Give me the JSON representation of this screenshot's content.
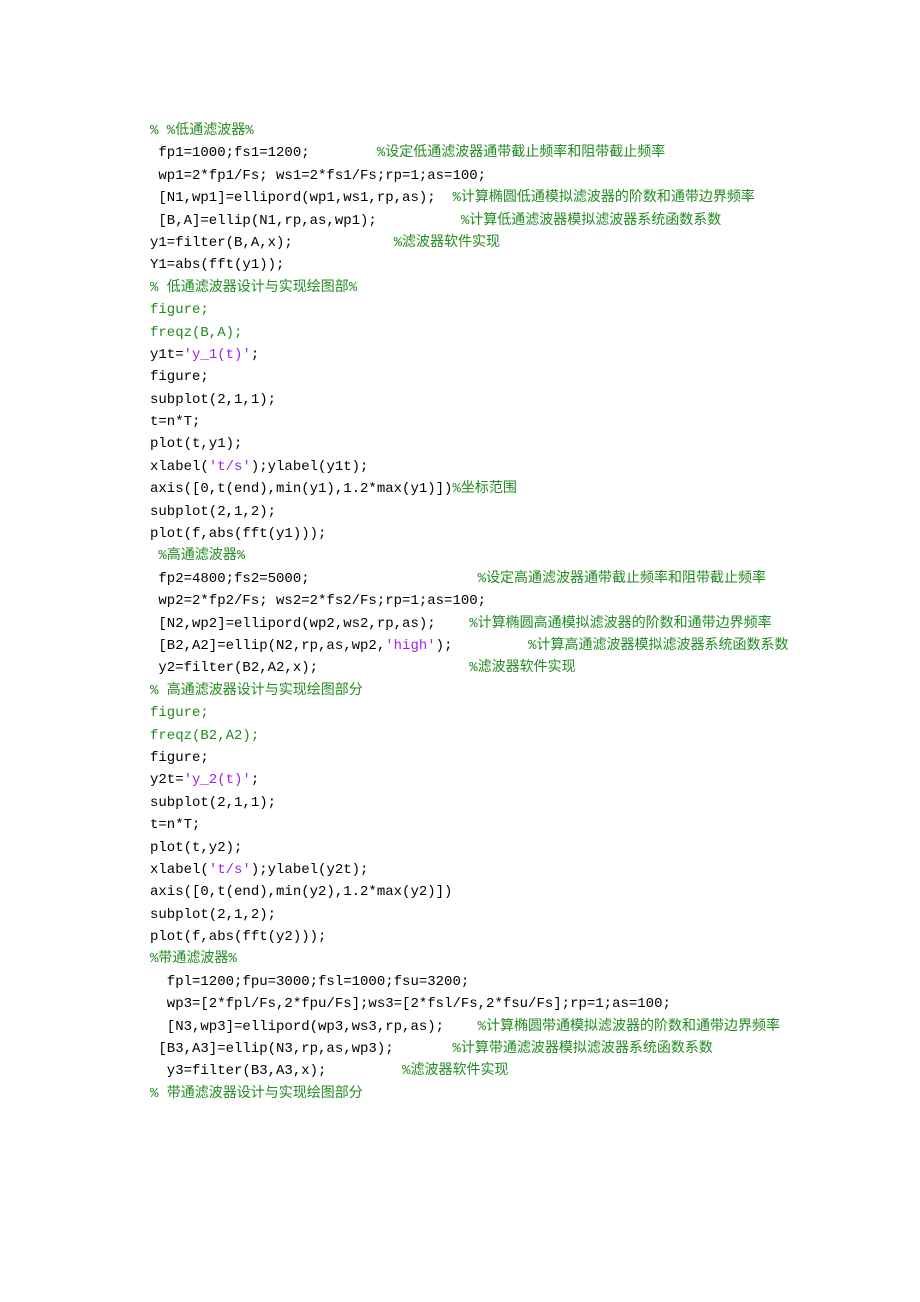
{
  "lines": [
    [
      {
        "t": "% %低通滤波器%",
        "cls": "comment"
      }
    ],
    [
      {
        "t": " fp1=1000;fs1=1200;        ",
        "cls": ""
      },
      {
        "t": "%设定低通滤波器通带截止频率和阻带截止频率",
        "cls": "comment"
      }
    ],
    [
      {
        "t": " wp1=2*fp1/Fs; ws1=2*fs1/Fs;rp=1;as=100;",
        "cls": ""
      }
    ],
    [
      {
        "t": " [N1,wp1]=ellipord(wp1,ws1,rp,as);  ",
        "cls": ""
      },
      {
        "t": "%计算椭圆低通模拟滤波器的阶数和通带边界频率",
        "cls": "comment"
      }
    ],
    [
      {
        "t": " [B,A]=ellip(N1,rp,as,wp1);          ",
        "cls": ""
      },
      {
        "t": "%计算低通滤波器模拟滤波器系统函数系数",
        "cls": "comment"
      }
    ],
    [
      {
        "t": "y1=filter(B,A,x);            ",
        "cls": ""
      },
      {
        "t": "%滤波器软件实现",
        "cls": "comment"
      }
    ],
    [
      {
        "t": "Y1=abs(fft(y1));",
        "cls": ""
      }
    ],
    [
      {
        "t": "% 低通滤波器设计与实现绘图部%",
        "cls": "comment"
      }
    ],
    [
      {
        "t": "figure;",
        "cls": "comment"
      }
    ],
    [
      {
        "t": "freqz(B,A);",
        "cls": "comment"
      }
    ],
    [
      {
        "t": "y1t=",
        "cls": ""
      },
      {
        "t": "'y_1(t)'",
        "cls": "string"
      },
      {
        "t": ";",
        "cls": ""
      }
    ],
    [
      {
        "t": "figure;",
        "cls": ""
      }
    ],
    [
      {
        "t": "subplot(2,1,1);",
        "cls": ""
      }
    ],
    [
      {
        "t": "t=n*T;",
        "cls": ""
      }
    ],
    [
      {
        "t": "plot(t,y1);",
        "cls": ""
      }
    ],
    [
      {
        "t": "xlabel(",
        "cls": ""
      },
      {
        "t": "'t/s'",
        "cls": "string"
      },
      {
        "t": ");ylabel(y1t);",
        "cls": ""
      }
    ],
    [
      {
        "t": "axis([0,t(end),min(y1),1.2*max(y1)])",
        "cls": ""
      },
      {
        "t": "%坐标范围",
        "cls": "comment"
      }
    ],
    [
      {
        "t": "subplot(2,1,2);",
        "cls": ""
      }
    ],
    [
      {
        "t": "plot(f,abs(fft(y1)));",
        "cls": ""
      }
    ],
    [
      {
        "t": " %高通滤波器%",
        "cls": "comment"
      }
    ],
    [
      {
        "t": " fp2=4800;fs2=5000;                    ",
        "cls": ""
      },
      {
        "t": "%设定高通滤波器通带截止频率和阻带截止频率",
        "cls": "comment"
      }
    ],
    [
      {
        "t": " wp2=2*fp2/Fs; ws2=2*fs2/Fs;rp=1;as=100;",
        "cls": ""
      }
    ],
    [
      {
        "t": " [N2,wp2]=ellipord(wp2,ws2,rp,as);    ",
        "cls": ""
      },
      {
        "t": "%计算椭圆高通模拟滤波器的阶数和通带边界频率",
        "cls": "comment"
      }
    ],
    [
      {
        "t": " [B2,A2]=ellip(N2,rp,as,wp2,",
        "cls": ""
      },
      {
        "t": "'high'",
        "cls": "string"
      },
      {
        "t": ");         ",
        "cls": ""
      },
      {
        "t": "%计算高通滤波器模拟滤波器系统函数系数",
        "cls": "comment"
      }
    ],
    [
      {
        "t": " y2=filter(B2,A2,x);                  ",
        "cls": ""
      },
      {
        "t": "%滤波器软件实现",
        "cls": "comment"
      }
    ],
    [
      {
        "t": "% 高通滤波器设计与实现绘图部分",
        "cls": "comment"
      }
    ],
    [
      {
        "t": "figure;",
        "cls": "comment"
      }
    ],
    [
      {
        "t": "freqz(B2,A2);",
        "cls": "comment"
      }
    ],
    [
      {
        "t": "figure;",
        "cls": ""
      }
    ],
    [
      {
        "t": "y2t=",
        "cls": ""
      },
      {
        "t": "'y_2(t)'",
        "cls": "string"
      },
      {
        "t": ";",
        "cls": ""
      }
    ],
    [
      {
        "t": "subplot(2,1,1);",
        "cls": ""
      }
    ],
    [
      {
        "t": "t=n*T;",
        "cls": ""
      }
    ],
    [
      {
        "t": "plot(t,y2);",
        "cls": ""
      }
    ],
    [
      {
        "t": "xlabel(",
        "cls": ""
      },
      {
        "t": "'t/s'",
        "cls": "string"
      },
      {
        "t": ");ylabel(y2t);",
        "cls": ""
      }
    ],
    [
      {
        "t": "axis([0,t(end),min(y2),1.2*max(y2)])",
        "cls": ""
      }
    ],
    [
      {
        "t": "subplot(2,1,2);",
        "cls": ""
      }
    ],
    [
      {
        "t": "plot(f,abs(fft(y2)));",
        "cls": ""
      }
    ],
    [
      {
        "t": "%带通滤波器%",
        "cls": "comment"
      }
    ],
    [
      {
        "t": "  fpl=1200;fpu=3000;fsl=1000;fsu=3200;",
        "cls": ""
      }
    ],
    [
      {
        "t": "  wp3=[2*fpl/Fs,2*fpu/Fs];ws3=[2*fsl/Fs,2*fsu/Fs];rp=1;as=100;",
        "cls": ""
      }
    ],
    [
      {
        "t": "  [N3,wp3]=ellipord(wp3,ws3,rp,as);    ",
        "cls": ""
      },
      {
        "t": "%计算椭圆带通模拟滤波器的阶数和通带边界频率",
        "cls": "comment"
      }
    ],
    [
      {
        "t": " [B3,A3]=ellip(N3,rp,as,wp3);       ",
        "cls": ""
      },
      {
        "t": "%计算带通滤波器模拟滤波器系统函数系数",
        "cls": "comment"
      }
    ],
    [
      {
        "t": "  y3=filter(B3,A3,x);         ",
        "cls": ""
      },
      {
        "t": "%滤波器软件实现",
        "cls": "comment"
      }
    ],
    [
      {
        "t": "% 带通滤波器设计与实现绘图部分",
        "cls": "comment"
      }
    ]
  ]
}
